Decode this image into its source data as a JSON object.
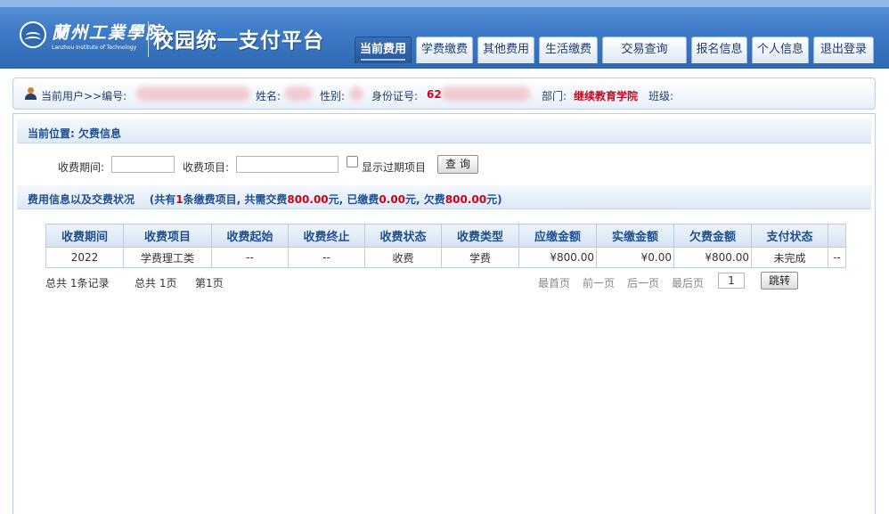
{
  "header": {
    "logo_text_cn": "蘭州工業學院",
    "logo_text_en": "Lanzhou Institute of Technology",
    "site_title": "校园统一支付平台"
  },
  "nav": {
    "tabs": [
      {
        "label": "当前费用",
        "active": true
      },
      {
        "label": "学费缴费",
        "active": false
      },
      {
        "label": "其他费用",
        "active": false
      },
      {
        "label": "生活缴费",
        "active": false
      },
      {
        "label": "交易查询",
        "active": false
      },
      {
        "label": "报名信息",
        "active": false
      },
      {
        "label": "个人信息",
        "active": false
      },
      {
        "label": "退出登录",
        "active": false
      }
    ]
  },
  "userbar": {
    "current_user_label": "当前用户>>编号:",
    "name_label": "姓名:",
    "gender_label": "性别:",
    "id_label": "身份证号:",
    "id_value_visible": "62",
    "dept_label": "部门:",
    "dept_value": "继续教育学院",
    "class_label": "班级:"
  },
  "location": {
    "text": "当前位置: 欠费信息"
  },
  "search": {
    "period_label": "收费期间:",
    "period_value": "",
    "item_label": "收费项目:",
    "item_value": "",
    "show_expired_label": "显示过期项目",
    "show_expired_checked": false,
    "query_button": "查 询"
  },
  "summary": {
    "prefix": "费用信息以及交费状况",
    "p1": "(共有",
    "count": "1",
    "p2": "条缴费项目, 共需交费",
    "total_due": "800.00",
    "p3": "元, 已缴费",
    "paid": "0.00",
    "p4": "元, 欠费",
    "owed": "800.00",
    "p5": "元)"
  },
  "table": {
    "headers": [
      "收费期间",
      "收费项目",
      "收费起始",
      "收费终止",
      "收费状态",
      "收费类型",
      "应缴金额",
      "实缴金额",
      "欠费金额",
      "支付状态",
      ""
    ],
    "rows": [
      [
        "2022",
        "学费理工类",
        "--",
        "--",
        "收费",
        "学费",
        "¥800.00",
        "¥0.00",
        "¥800.00",
        "未完成",
        "--"
      ]
    ]
  },
  "pager": {
    "total_records": "总共  1条记录",
    "total_pages": "总共  1页",
    "current_page": "第1页",
    "first": "最首页",
    "prev": "前一页",
    "next": "后一页",
    "last": "最后页",
    "page_input": "1",
    "jump_button": "跳转"
  }
}
